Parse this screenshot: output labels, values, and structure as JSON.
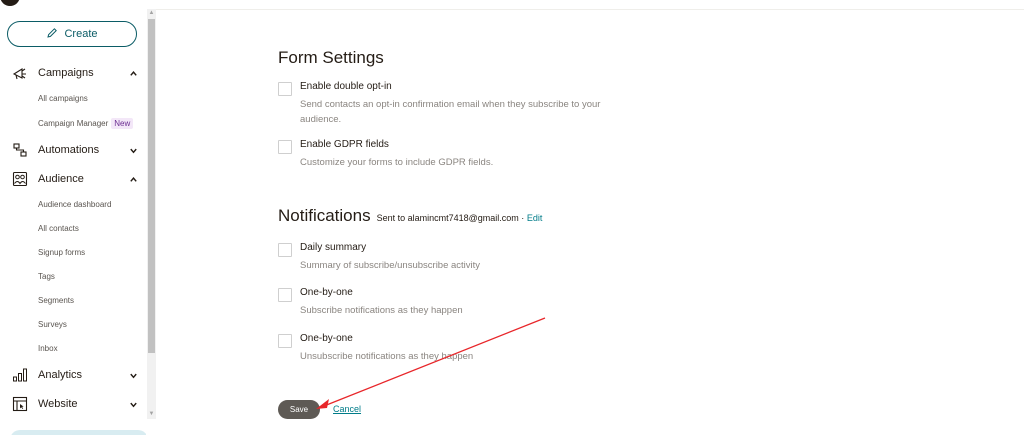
{
  "sidebar": {
    "create_label": "Create",
    "nav": {
      "campaigns": "Campaigns",
      "all_campaigns": "All campaigns",
      "campaign_manager": "Campaign Manager",
      "new_badge": "New",
      "automations": "Automations",
      "audience": "Audience",
      "audience_dashboard": "Audience dashboard",
      "all_contacts": "All contacts",
      "signup_forms": "Signup forms",
      "tags": "Tags",
      "segments": "Segments",
      "surveys": "Surveys",
      "inbox": "Inbox",
      "analytics": "Analytics",
      "website": "Website"
    }
  },
  "form_settings": {
    "title": "Form Settings",
    "double_opt_in": {
      "label": "Enable double opt-in",
      "description": "Send contacts an opt-in confirmation email when they subscribe to your audience."
    },
    "gdpr": {
      "label": "Enable GDPR fields",
      "description": "Customize your forms to include GDPR fields."
    }
  },
  "notifications": {
    "title": "Notifications",
    "sent_to_prefix": "Sent to alamincmt7418@gmail.com · ",
    "edit_label": "Edit",
    "daily_summary": {
      "label": "Daily summary",
      "description": "Summary of subscribe/unsubscribe activity"
    },
    "subscribe": {
      "label": "One-by-one",
      "description": "Subscribe notifications as they happen"
    },
    "unsubscribe": {
      "label": "One-by-one",
      "description": "Unsubscribe notifications as they happen"
    }
  },
  "actions": {
    "save_label": "Save",
    "cancel_label": "Cancel"
  },
  "colors": {
    "brand_teal": "#007c89",
    "annotation_arrow": "#e8262a",
    "save_button": "#5e5a55"
  },
  "icons": {
    "create": "pencil-icon",
    "campaigns": "megaphone-icon",
    "automations": "workflow-icon",
    "audience": "people-icon",
    "analytics": "bar-chart-icon",
    "website": "browser-window-icon"
  }
}
